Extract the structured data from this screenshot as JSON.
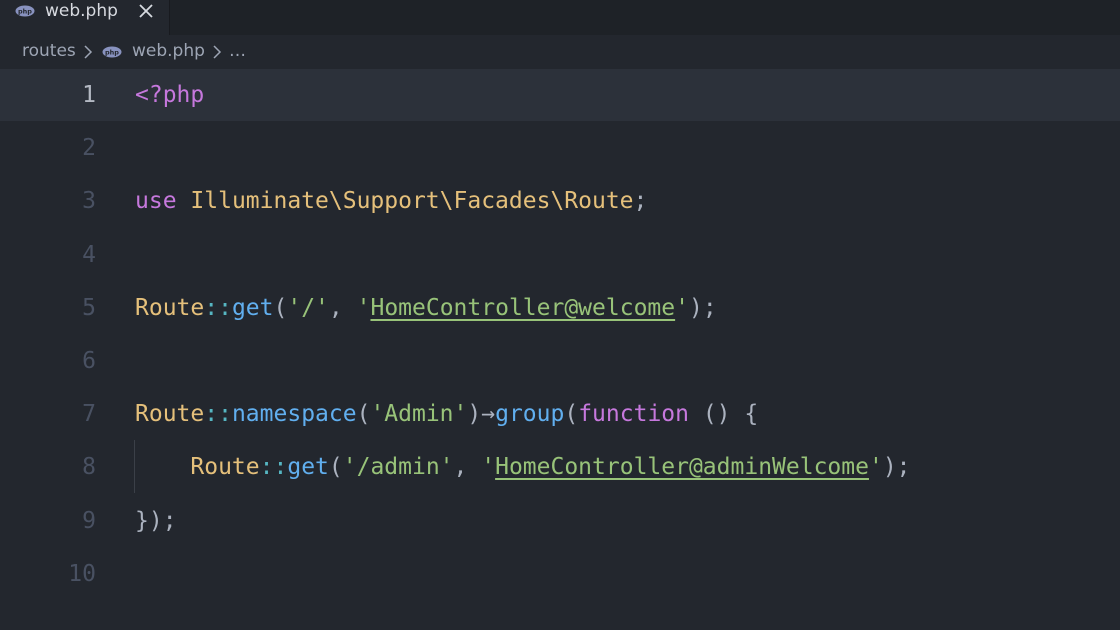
{
  "tab": {
    "title": "web.php",
    "icon": "php-icon",
    "close_icon": "close-icon"
  },
  "breadcrumbs": {
    "folder": "routes",
    "file": "web.php",
    "more": "…"
  },
  "editor": {
    "active_line": 1,
    "lines": [
      {
        "num": "1",
        "tokens": [
          {
            "t": "<?php",
            "c": "kw"
          }
        ]
      },
      {
        "num": "2",
        "tokens": []
      },
      {
        "num": "3",
        "tokens": [
          {
            "t": "use",
            "c": "kw"
          },
          {
            "t": " ",
            "c": "pun"
          },
          {
            "t": "Illuminate\\Support\\Facades\\Route",
            "c": "ns"
          },
          {
            "t": ";",
            "c": "pun"
          }
        ]
      },
      {
        "num": "4",
        "tokens": []
      },
      {
        "num": "5",
        "tokens": [
          {
            "t": "Route",
            "c": "cls"
          },
          {
            "t": "::",
            "c": "op"
          },
          {
            "t": "get",
            "c": "fn"
          },
          {
            "t": "(",
            "c": "pun"
          },
          {
            "t": "'/'",
            "c": "str"
          },
          {
            "t": ", ",
            "c": "pun"
          },
          {
            "t": "'",
            "c": "str"
          },
          {
            "t": "HomeController@welcome",
            "c": "str ul"
          },
          {
            "t": "'",
            "c": "str"
          },
          {
            "t": ");",
            "c": "pun"
          }
        ]
      },
      {
        "num": "6",
        "tokens": []
      },
      {
        "num": "7",
        "tokens": [
          {
            "t": "Route",
            "c": "cls"
          },
          {
            "t": "::",
            "c": "op"
          },
          {
            "t": "namespace",
            "c": "fn"
          },
          {
            "t": "(",
            "c": "pun"
          },
          {
            "t": "'Admin'",
            "c": "str"
          },
          {
            "t": ")",
            "c": "pun"
          },
          {
            "t": "→",
            "c": "pun"
          },
          {
            "t": "group",
            "c": "fn"
          },
          {
            "t": "(",
            "c": "pun"
          },
          {
            "t": "function",
            "c": "kw"
          },
          {
            "t": " () {",
            "c": "pun"
          }
        ]
      },
      {
        "num": "8",
        "tokens": [
          {
            "t": "    ",
            "c": "pun"
          },
          {
            "t": "Route",
            "c": "cls"
          },
          {
            "t": "::",
            "c": "op"
          },
          {
            "t": "get",
            "c": "fn"
          },
          {
            "t": "(",
            "c": "pun"
          },
          {
            "t": "'/admin'",
            "c": "str"
          },
          {
            "t": ", ",
            "c": "pun"
          },
          {
            "t": "'",
            "c": "str"
          },
          {
            "t": "HomeController@adminWelcome",
            "c": "str ul"
          },
          {
            "t": "'",
            "c": "str"
          },
          {
            "t": ");",
            "c": "pun"
          }
        ]
      },
      {
        "num": "9",
        "tokens": [
          {
            "t": "});",
            "c": "pun"
          }
        ]
      },
      {
        "num": "10",
        "tokens": []
      }
    ]
  }
}
